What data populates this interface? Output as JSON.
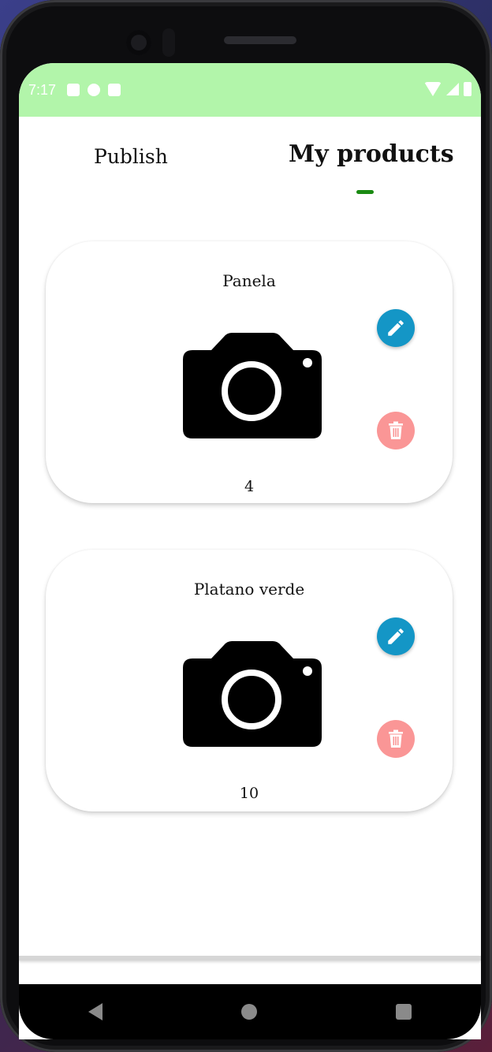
{
  "status_bar": {
    "time": "7:17",
    "left_icons": [
      "a-icon",
      "p-icon",
      "sd-card-icon"
    ],
    "right_icons": [
      "wifi-icon",
      "signal-icon",
      "battery-icon"
    ],
    "background_color": "#b2f5aa"
  },
  "tabs": {
    "items": [
      {
        "label": "Publish",
        "selected": false
      },
      {
        "label": "My products",
        "selected": true
      }
    ],
    "indicator_color": "#1a8a12"
  },
  "products": [
    {
      "name": "Panela",
      "quantity": "4",
      "image_icon": "camera-icon"
    },
    {
      "name": "Platano verde",
      "quantity": "10",
      "image_icon": "camera-icon"
    }
  ],
  "actions": {
    "edit_icon": "pencil-icon",
    "edit_color": "#1496c6",
    "delete_icon": "trash-icon",
    "delete_color": "#fa9696"
  },
  "nav_bar": {
    "buttons": [
      "back-icon",
      "home-icon",
      "recents-icon"
    ]
  }
}
